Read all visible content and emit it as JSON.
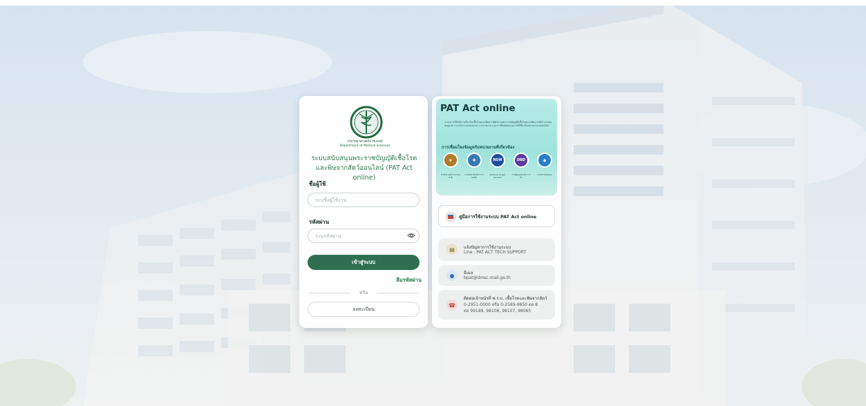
{
  "login": {
    "system_title_line1": "ระบบสนับสนุนพระราชบัญญัติเชื้อโรค",
    "system_title_line2": "และพิษจากสัตว์ออนไลน์ (PAT Act online)",
    "logo_caption_th": "กรมวิทยาศาสตร์การแพทย์",
    "logo_caption_en": "Department of Medical Sciences",
    "username_label": "ชื่อผู้ใช้",
    "username_placeholder": "ระบุชื่อผู้ใช้งาน",
    "password_label": "รหัสผ่าน",
    "password_placeholder": "ระบุรหัสผ่าน",
    "login_button": "เข้าสู่ระบบ",
    "forgot_password": "ลืมรหัสผ่าน",
    "divider_text": "หรือ",
    "register_button": "ลงทะเบียน"
  },
  "banner": {
    "title": "PAT Act online",
    "description": "ระบบการให้บริการเกี่ยวกับเชื้อโรคและพิษจากสัตว์ตามพระราชบัญญัติเชื้อโรคและพิษจากสัตว์ การขออนุญาต การแจ้งการครอบครอง การรายงาน และการติดต่อหน่วยงานที่เกี่ยวข้องผ่านระบบออนไลน์",
    "subtitle": "การเชื่อมโยงข้อมูลกับหน่วยงานที่เกี่ยวข้อง",
    "partners": [
      {
        "icon": "thai-agency-seal-icon",
        "caption": "สำนักงานตำรวจ แห่งชาติ",
        "color": "#b07a2a"
      },
      {
        "icon": "dms-seal-icon",
        "caption": "กรมวิทยาศาสตร์ การแพทย์",
        "color": "#3a78b5"
      },
      {
        "icon": "nsw-icon",
        "caption": "National Single Window",
        "color": "#1c4fa0"
      },
      {
        "icon": "dbd-icon",
        "caption": "กรมพัฒนาธุรกิจ การค้า",
        "color": "#5a3e9e"
      },
      {
        "icon": "dopa-icon",
        "caption": "กรมการปกครอง",
        "color": "#2a7fc9"
      }
    ]
  },
  "manual": {
    "label": "คู่มือการใช้งานระบบ PAT Act online"
  },
  "contacts": [
    {
      "icon": "report-issue-icon",
      "title": "แจ้งปัญหาการใช้งานระบบ",
      "lines": [
        "Line : PAT ACT TECH SUPPORT"
      ]
    },
    {
      "icon": "email-icon",
      "title": "อีเมล",
      "lines": [
        "bpat@dmsc.mail.go.th"
      ]
    },
    {
      "icon": "phone-icon",
      "title": "ติดต่อเจ้าหน้าที่ พ.ร.บ. เชื้อโรคและพิษจากสัตว์",
      "lines": [
        "0-2951-0000 หรือ 0-2589-9850 ต่อ 8",
        "ต่อ 99189, 98106, 98107, 98065"
      ]
    }
  ],
  "colors": {
    "primary_green": "#2f6f50",
    "accent_green": "#2f7a52",
    "banner_teal": "#9ee3dc"
  }
}
